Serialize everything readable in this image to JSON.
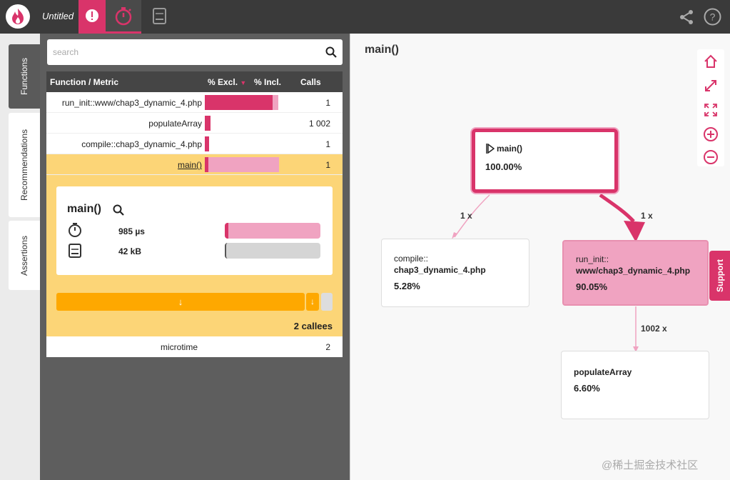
{
  "app": {
    "title": "Untitled"
  },
  "colors": {
    "accent": "#d9346a",
    "accent_light": "#f0a3c1",
    "selected_row": "#fcd577",
    "expand": "#fea800"
  },
  "sidebar_tabs": {
    "functions": "Functions",
    "recommendations": "Recommendations",
    "assertions": "Assertions"
  },
  "search": {
    "placeholder": "search",
    "value": ""
  },
  "table": {
    "headers": {
      "function": "Function / Metric",
      "excl": "% Excl.",
      "incl": "% Incl.",
      "calls": "Calls"
    },
    "rows": [
      {
        "name": "run_init::www/chap3_dynamic_4.php",
        "excl_pct": 83.45,
        "incl_pct": 90.05,
        "calls": "1"
      },
      {
        "name": "populateArray",
        "excl_pct": 6.6,
        "incl_pct": 6.6,
        "calls": "1 002"
      },
      {
        "name": "compile::chap3_dynamic_4.php",
        "excl_pct": 5.28,
        "incl_pct": 5.28,
        "calls": "1"
      },
      {
        "name": "main()",
        "excl_pct": 4.0,
        "incl_pct": 100.0,
        "calls": "1"
      }
    ]
  },
  "detail": {
    "name": "main()",
    "time": "985 µs",
    "memory": "42 kB",
    "time_excl_pct": 4.0,
    "time_incl_pct": 100.0,
    "memory_pct": 100.0,
    "expand_arrow": "↓",
    "callees": "2 callees"
  },
  "sub_row": {
    "name": "microtime",
    "calls": "2"
  },
  "graph": {
    "title": "main()",
    "nodes": {
      "main": {
        "label": "main()",
        "pct": "100.00%"
      },
      "compile": {
        "label1": "compile::",
        "label2": "chap3_dynamic_4.php",
        "pct": "5.28%"
      },
      "runinit": {
        "label1": "run_init::",
        "label2": "www/chap3_dynamic_4.php",
        "pct": "90.05%"
      },
      "populate": {
        "label": "populateArray",
        "pct": "6.60%"
      }
    },
    "edges": {
      "main_compile": "1 x",
      "main_runinit": "1 x",
      "runinit_populate": "1002 x"
    }
  },
  "support": {
    "label": "Support"
  },
  "watermark": "@稀土掘金技术社区",
  "icons": {
    "logo": "flame-logo-icon",
    "alert": "alert-icon",
    "timer": "timer-icon",
    "memory": "memory-icon",
    "share": "share-icon",
    "help": "help-icon",
    "search": "search-icon",
    "home": "home-icon",
    "expand": "expand-icon",
    "fit": "fit-icon",
    "zoom_in": "zoom-in-icon",
    "zoom_out": "zoom-out-icon"
  }
}
